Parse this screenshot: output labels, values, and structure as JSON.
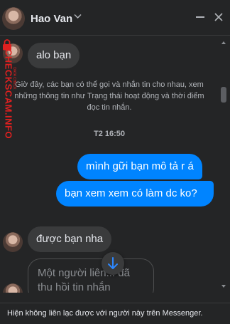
{
  "header": {
    "contact_name": "Hao Van",
    "minimize_icon": "minimize-icon",
    "close_icon": "close-icon"
  },
  "watermark": {
    "text": "CHECKSCAM.INFO",
    "small_text": "DATA CHECK"
  },
  "conversation": {
    "messages": [
      {
        "direction": "in",
        "text": "alo bạn"
      },
      {
        "direction": "out",
        "text": "mình gữi bạn mô tả r á"
      },
      {
        "direction": "out",
        "text": "bạn xem xem có làm dc ko?"
      },
      {
        "direction": "in",
        "text": "được bạn nha"
      }
    ],
    "notice": "Giờ đây, các bạn có thể gọi và nhắn tin cho nhau, xem những thông tin như Trạng thái hoạt động và thời điểm đọc tin nhắn.",
    "timestamp": "T2 16:50",
    "recalled_message": "Một người liên... đã thu hồi tin nhắn"
  },
  "footer": {
    "status_text": "Hiện không liên lạc được với người này trên Messenger."
  },
  "colors": {
    "background": "#242526",
    "incoming_bubble": "#3a3b3c",
    "outgoing_bubble": "#0084ff",
    "scroll_arrow": "#2d88ff",
    "watermark": "#e02020"
  }
}
